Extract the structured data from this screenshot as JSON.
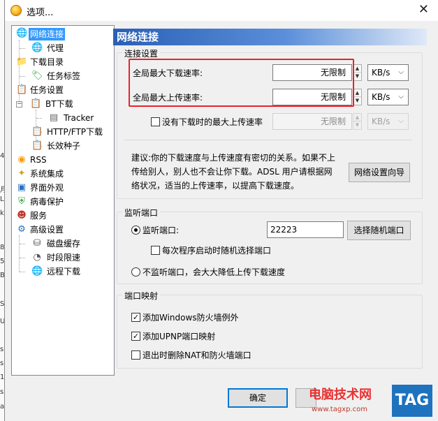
{
  "window": {
    "title": "选项..."
  },
  "left_edge": [
    "4",
    "月",
    "L",
    "k",
    "8",
    "5",
    "B",
    "S",
    "U",
    "s",
    "s",
    "1",
    "s",
    "a"
  ],
  "tree": {
    "items": [
      {
        "label": "网络连接",
        "icon": "globe-network-icon",
        "selected": true
      },
      {
        "label": "代理",
        "icon": "proxy-globe-icon"
      },
      {
        "label": "下载目录",
        "icon": "folder-icon"
      },
      {
        "label": "任务标签",
        "icon": "tag-icon"
      },
      {
        "label": "任务设置",
        "icon": "task-clipboard-icon"
      },
      {
        "label": "BT下载",
        "icon": "bt-clipboard-icon"
      },
      {
        "label": "Tracker",
        "icon": "server-icon"
      },
      {
        "label": "HTTP/FTP下载",
        "icon": "http-icon"
      },
      {
        "label": "长效种子",
        "icon": "seed-icon"
      },
      {
        "label": "RSS",
        "icon": "rss-icon"
      },
      {
        "label": "系统集成",
        "icon": "puzzle-icon"
      },
      {
        "label": "界面外观",
        "icon": "appearance-icon"
      },
      {
        "label": "病毒保护",
        "icon": "shield-icon"
      },
      {
        "label": "服务",
        "icon": "service-icon"
      },
      {
        "label": "高级设置",
        "icon": "advanced-icon"
      },
      {
        "label": "磁盘缓存",
        "icon": "disk-icon"
      },
      {
        "label": "时段限速",
        "icon": "clock-icon"
      },
      {
        "label": "远程下载",
        "icon": "remote-globe-icon"
      }
    ]
  },
  "pane": {
    "header": "网络连接",
    "connection": {
      "title": "连接设置",
      "max_download_label": "全局最大下载速率:",
      "max_download_value": "无限制",
      "max_upload_label": "全局最大上传速率:",
      "max_upload_value": "无限制",
      "idle_upload_label": "没有下载时的最大上传速率",
      "idle_upload_value": "无限制",
      "unit": "KB/s",
      "advice_lines": [
        "建议:你的下载速度与上传速度有密切的关系。如果不上",
        "传给别人，别人也不会让你下载。ADSL 用户请根据网",
        "络状况，适当的上传速率，以提高下载速度。"
      ],
      "wizard_button": "网络设置向导"
    },
    "listen": {
      "title": "监听端口",
      "listen_label": "监听端口:",
      "port_value": "22223",
      "random_button": "选择随机端口",
      "random_each_start_label": "每次程序启动时随机选择端口",
      "no_listen_label": "不监听端口，会大大降低上传下载速度"
    },
    "mapping": {
      "title": "端口映射",
      "firewall_label": "添加Windows防火墙例外",
      "upnp_label": "添加UPNP端口映射",
      "remove_label": "退出时删除NAT和防火墙端口"
    }
  },
  "buttons": {
    "ok": "确定"
  },
  "watermark": {
    "title": "电脑技术网",
    "url": "www.tagxp.com",
    "tag": "TAG"
  },
  "colors": {
    "header_blue": "#2a5fb6",
    "selection": "#3399ff",
    "highlight_red": "#e8232a"
  }
}
